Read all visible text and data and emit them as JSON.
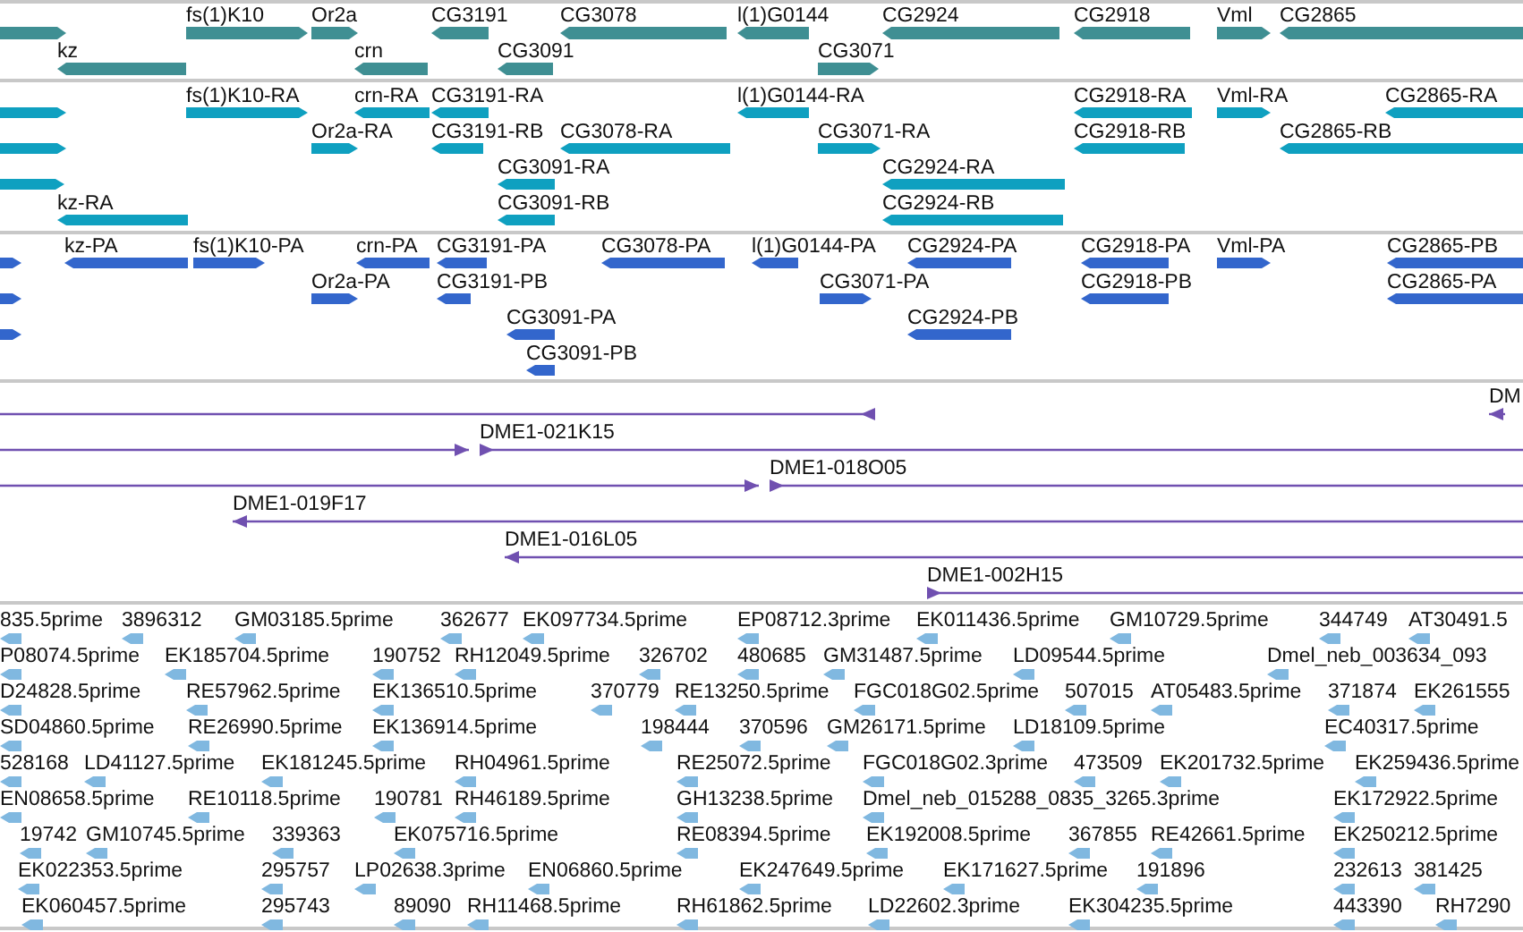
{
  "tracks": [
    {
      "kind": "gene",
      "lanes": [
        {
          "features": [
            {
              "forward": true
            },
            {
              "label": "fs(1)K10",
              "forward": true
            },
            {
              "label": "Or2a",
              "forward": true
            },
            {
              "label": "CG3191",
              "forward": false
            },
            {
              "label": "CG3078",
              "forward": false
            },
            {
              "label": "l(1)G0144",
              "forward": false
            },
            {
              "label": "CG2924",
              "forward": false
            },
            {
              "label": "CG2918",
              "forward": false
            },
            {
              "label": "Vml",
              "forward": true
            },
            {
              "label": "CG2865",
              "forward": false
            }
          ]
        },
        {
          "features": [
            {
              "label": "kz",
              "forward": false
            },
            {
              "label": "crn",
              "forward": false
            },
            {
              "label": "CG3091",
              "forward": false
            },
            {
              "label": "CG3071",
              "forward": true
            }
          ]
        }
      ]
    },
    {
      "kind": "transcript",
      "lanes": [
        {
          "features": [
            {
              "forward": true
            },
            {
              "label": "fs(1)K10-RA",
              "forward": true
            },
            {
              "label": "crn-RA",
              "forward": false
            },
            {
              "label": "CG3191-RA",
              "forward": false
            },
            {
              "label": "l(1)G0144-RA",
              "forward": false
            },
            {
              "label": "CG2918-RA",
              "forward": false
            },
            {
              "label": "Vml-RA",
              "forward": true
            },
            {
              "label": "CG2865-RA",
              "forward": false
            }
          ]
        },
        {
          "features": [
            {
              "forward": true
            },
            {
              "label": "Or2a-RA",
              "forward": true
            },
            {
              "label": "CG3191-RB",
              "forward": false
            },
            {
              "label": "CG3078-RA",
              "forward": false
            },
            {
              "label": "CG3071-RA",
              "forward": true
            },
            {
              "label": "CG2918-RB",
              "forward": false
            },
            {
              "label": "CG2865-RB",
              "forward": false
            }
          ]
        },
        {
          "features": [
            {
              "forward": true
            },
            {
              "label": "CG3091-RA",
              "forward": false
            },
            {
              "label": "CG2924-RA",
              "forward": false
            }
          ]
        },
        {
          "features": [
            {
              "label": "kz-RA",
              "forward": false
            },
            {
              "label": "CG3091-RB",
              "forward": false
            },
            {
              "label": "CG2924-RB",
              "forward": false
            }
          ]
        }
      ]
    },
    {
      "kind": "protein",
      "lanes": [
        {
          "features": [
            {
              "forward": true
            },
            {
              "label": "kz-PA",
              "forward": false
            },
            {
              "label": "fs(1)K10-PA",
              "forward": true
            },
            {
              "label": "crn-PA",
              "forward": false
            },
            {
              "label": "CG3191-PA",
              "forward": false
            },
            {
              "label": "CG3078-PA",
              "forward": false
            },
            {
              "label": "l(1)G0144-PA",
              "forward": false
            },
            {
              "label": "CG2924-PA",
              "forward": false
            },
            {
              "label": "CG2918-PA",
              "forward": false
            },
            {
              "label": "Vml-PA",
              "forward": true
            },
            {
              "label": "CG2865-PB",
              "forward": false
            }
          ]
        },
        {
          "features": [
            {
              "forward": true
            },
            {
              "label": "Or2a-PA",
              "forward": true
            },
            {
              "label": "CG3191-PB",
              "forward": false
            },
            {
              "label": "CG3071-PA",
              "forward": true
            },
            {
              "label": "CG2918-PB",
              "forward": false
            },
            {
              "label": "CG2865-PA",
              "forward": false
            }
          ]
        },
        {
          "features": [
            {
              "forward": true
            },
            {
              "label": "CG3091-PA",
              "forward": false
            },
            {
              "label": "CG2924-PB",
              "forward": false
            }
          ]
        },
        {
          "features": [
            {
              "label": "CG3091-PB",
              "forward": false
            }
          ]
        }
      ]
    },
    {
      "kind": "clone",
      "lanes": [
        {
          "features": [
            {
              "forward": false
            },
            {
              "label": "DM",
              "forward": false
            }
          ]
        },
        {
          "features": [
            {
              "forward": true
            },
            {
              "label": "DME1-021K15",
              "forward": true
            }
          ]
        },
        {
          "features": [
            {
              "forward": true
            },
            {
              "label": "DME1-018O05",
              "forward": true
            }
          ]
        },
        {
          "features": [
            {
              "label": "DME1-019F17",
              "forward": false
            }
          ]
        },
        {
          "features": [
            {
              "label": "DME1-016L05",
              "forward": false
            }
          ]
        },
        {
          "features": [
            {
              "label": "DME1-002H15",
              "forward": true
            }
          ]
        }
      ]
    },
    {
      "kind": "est",
      "lanes": [
        {
          "features": [
            {
              "label": "835.5prime"
            },
            {
              "label": "3896312"
            },
            {
              "label": "GM03185.5prime"
            },
            {
              "label": "362677"
            },
            {
              "label": "EK097734.5prime"
            },
            {
              "label": "EP08712.3prime"
            },
            {
              "label": "EK011436.5prime"
            },
            {
              "label": "GM10729.5prime"
            },
            {
              "label": "344749"
            },
            {
              "label": "AT30491.5"
            }
          ]
        },
        {
          "features": [
            {
              "label": "P08074.5prime"
            },
            {
              "label": "EK185704.5prime"
            },
            {
              "label": "190752"
            },
            {
              "label": "RH12049.5prime"
            },
            {
              "label": "326702"
            },
            {
              "label": "480685"
            },
            {
              "label": "GM31487.5prime"
            },
            {
              "label": "LD09544.5prime"
            },
            {
              "label": "Dmel_neb_003634_093"
            }
          ]
        },
        {
          "features": [
            {
              "label": "D24828.5prime"
            },
            {
              "label": "RE57962.5prime"
            },
            {
              "label": "EK136510.5prime"
            },
            {
              "label": "370779"
            },
            {
              "label": "RE13250.5prime"
            },
            {
              "label": "FGC018G02.5prime"
            },
            {
              "label": "507015"
            },
            {
              "label": "AT05483.5prime"
            },
            {
              "label": "371874"
            },
            {
              "label": "EK261555"
            }
          ]
        },
        {
          "features": [
            {
              "label": "SD04860.5prime"
            },
            {
              "label": "RE26990.5prime"
            },
            {
              "label": "EK136914.5prime"
            },
            {
              "label": "198444"
            },
            {
              "label": "370596"
            },
            {
              "label": "GM26171.5prime"
            },
            {
              "label": "LD18109.5prime"
            },
            {
              "label": "EC40317.5prime"
            }
          ]
        },
        {
          "features": [
            {
              "label": "528168"
            },
            {
              "label": "LD41127.5prime"
            },
            {
              "label": "EK181245.5prime"
            },
            {
              "label": "RH04961.5prime"
            },
            {
              "label": "RE25072.5prime"
            },
            {
              "label": "FGC018G02.3prime"
            },
            {
              "label": "473509"
            },
            {
              "label": "EK201732.5prime"
            },
            {
              "label": "EK259436.5prime"
            }
          ]
        },
        {
          "features": [
            {
              "label": "EN08658.5prime"
            },
            {
              "label": "RE10118.5prime"
            },
            {
              "label": "190781"
            },
            {
              "label": "RH46189.5prime"
            },
            {
              "label": "GH13238.5prime"
            },
            {
              "label": "Dmel_neb_015288_0835_3265.3prime"
            },
            {
              "label": "EK172922.5prime"
            }
          ]
        },
        {
          "features": [
            {
              "label": "19742"
            },
            {
              "label": "GM10745.5prime"
            },
            {
              "label": "339363"
            },
            {
              "label": "EK075716.5prime"
            },
            {
              "label": "RE08394.5prime"
            },
            {
              "label": "EK192008.5prime"
            },
            {
              "label": "367855"
            },
            {
              "label": "RE42661.5prime"
            },
            {
              "label": "EK250212.5prime"
            }
          ]
        },
        {
          "features": [
            {
              "label": "EK022353.5prime"
            },
            {
              "label": "295757"
            },
            {
              "label": "LP02638.3prime"
            },
            {
              "label": "EN06860.5prime"
            },
            {
              "label": "EK247649.5prime"
            },
            {
              "label": "EK171627.5prime"
            },
            {
              "label": "191896"
            },
            {
              "label": "232613"
            },
            {
              "label": "381425"
            }
          ]
        },
        {
          "features": [
            {
              "label": "EK060457.5prime"
            },
            {
              "label": "295743"
            },
            {
              "label": "89090"
            },
            {
              "label": "RH11468.5prime"
            },
            {
              "label": "RH61862.5prime"
            },
            {
              "label": "LD22602.3prime"
            },
            {
              "label": "EK304235.5prime"
            },
            {
              "label": "443390"
            },
            {
              "label": "RH7290"
            }
          ]
        }
      ]
    }
  ]
}
